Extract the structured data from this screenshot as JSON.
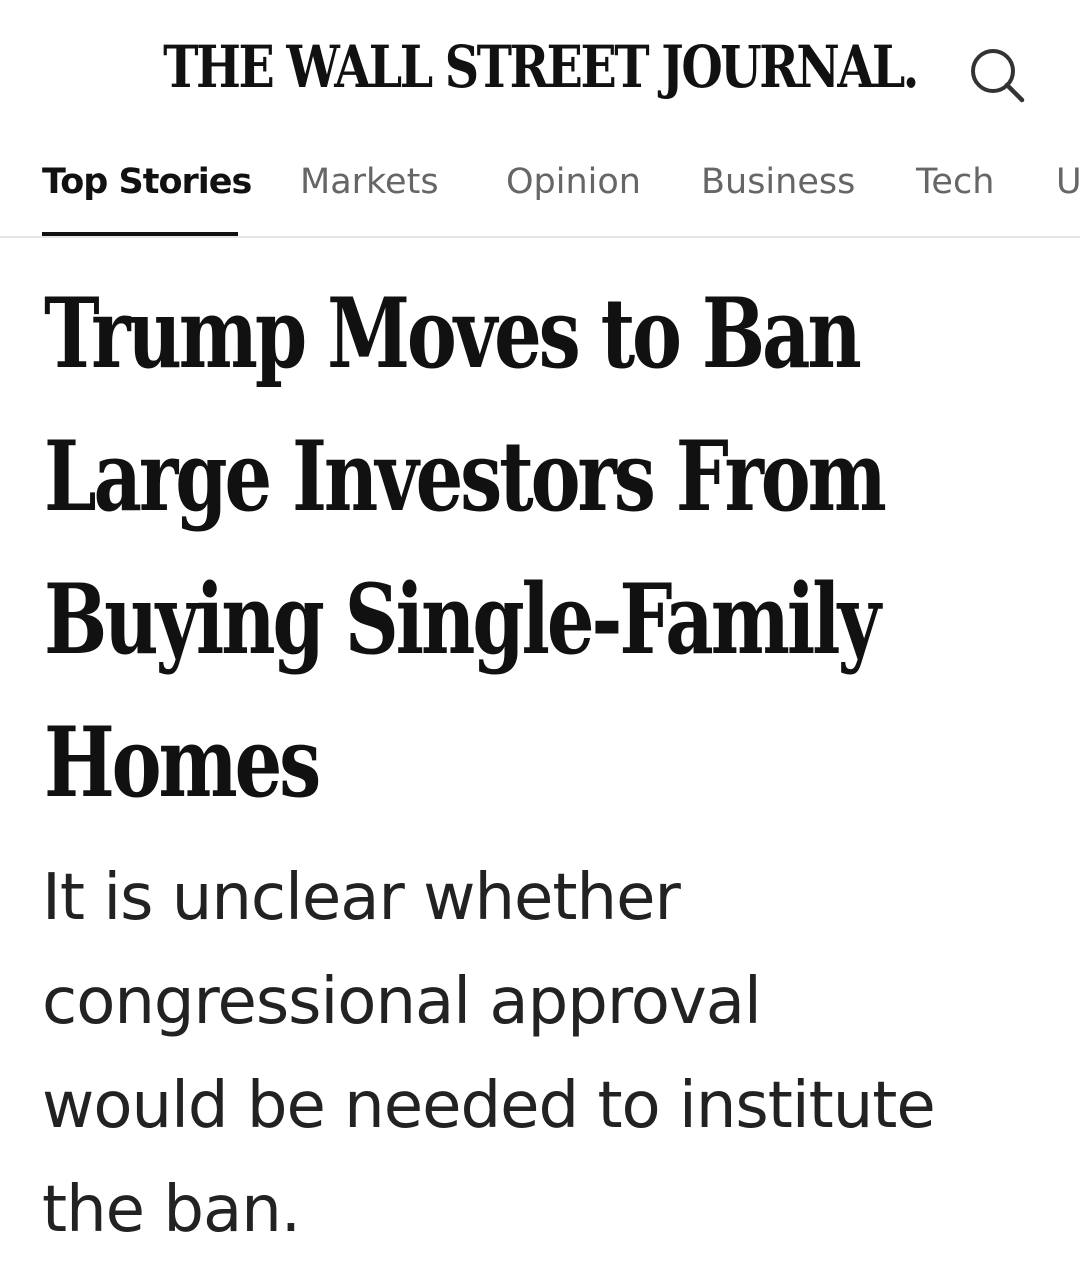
{
  "masthead": {
    "logo_text": "THE WALL STREET JOURNAL.",
    "search_icon": "search-icon"
  },
  "nav": {
    "tabs": [
      {
        "label": "Top Stories",
        "active": true
      },
      {
        "label": "Markets",
        "active": false
      },
      {
        "label": "Opinion",
        "active": false
      },
      {
        "label": "Business",
        "active": false
      },
      {
        "label": "Tech",
        "active": false
      },
      {
        "label": "U",
        "active": false
      }
    ]
  },
  "article": {
    "headline_lines": [
      "Trump Moves to Ban",
      "Large Investors From",
      "Buying Single-Family",
      "Homes"
    ],
    "dek_lines": [
      "It is unclear whether",
      "congressional approval",
      "would be needed to institute",
      "the ban."
    ]
  },
  "colors": {
    "text_primary": "#111111",
    "text_secondary": "#666666",
    "divider": "#e6e6e6",
    "background": "#ffffff"
  }
}
